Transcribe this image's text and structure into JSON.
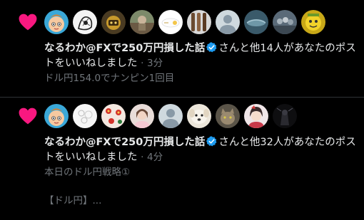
{
  "notifications": [
    {
      "icon": "heart-icon",
      "name": "なるわか@FXで250万円損した話",
      "summary": "さんと他14人があなたのポス",
      "summary_wrap": "トをいいねしました",
      "sep": "·",
      "time": "3分",
      "preview": "ドル円154.0でナンピン1回目",
      "avatars": [
        "orange-cartoon",
        "sketch",
        "gold-figure",
        "photo-outdoor",
        "white-sticker",
        "wood-figure",
        "default-person",
        "water-photo",
        "crowd-photo",
        "gold-mascot"
      ]
    },
    {
      "icon": "heart-icon",
      "name": "なるわか@FXで250万円損した話",
      "summary": "さんと他32人があなたのポス",
      "summary_wrap": "トをいいねしました",
      "sep": "·",
      "time": "4分",
      "preview": "本日のドル円戦略①",
      "preview_2": "【ドル円】...",
      "avatars": [
        "orange-cartoon",
        "white-sketch",
        "red-pattern",
        "girl-photo",
        "default-person",
        "white-dog",
        "cat-photo",
        "anime-girl",
        "dark-figure"
      ]
    }
  ],
  "colors": {
    "heart": "#f91880",
    "verified": "#1d9bf0",
    "text": "#e7e9ea",
    "muted": "#71767b",
    "divider": "#2f3336",
    "background": "#000000"
  }
}
